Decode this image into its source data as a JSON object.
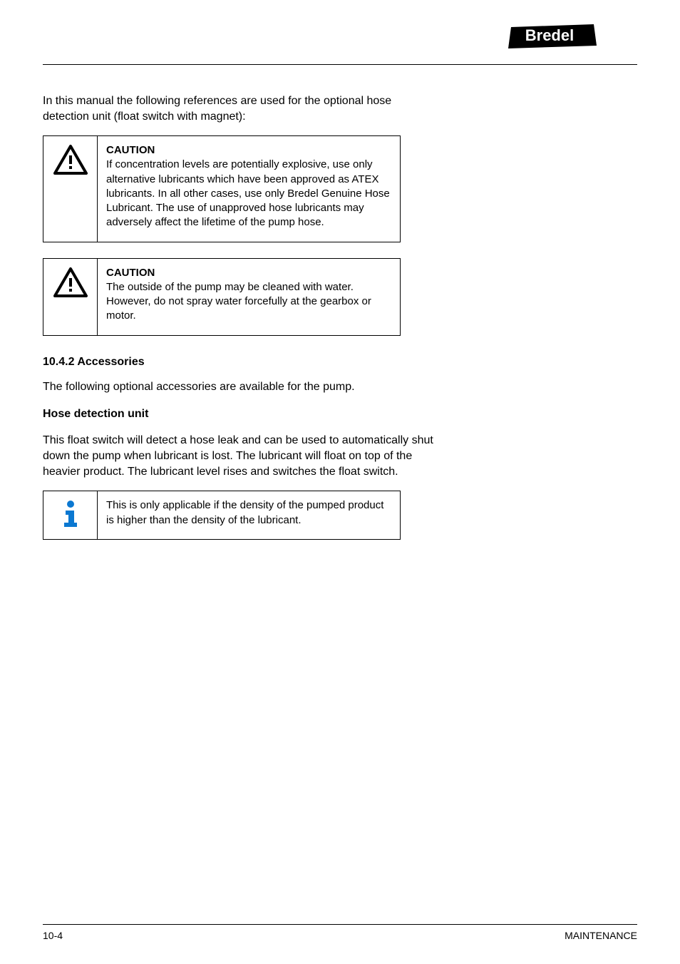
{
  "brand": "Bredel",
  "intro_paragraph": "In this manual the following references are used for the optional hose detection unit (float switch with magnet):",
  "callouts": [
    {
      "heading": "CAUTION",
      "body": "If concentration levels are potentially explosive, use only alternative lubricants which have been approved as ATEX lubricants. In all other cases, use only Bredel Genuine Hose Lubricant. The use of unapproved hose lubricants may adversely affect the lifetime of the pump hose."
    },
    {
      "heading": "CAUTION",
      "body": "The outside of the pump may be cleaned with water. However, do not spray water forcefully at the gearbox or motor."
    }
  ],
  "section_heading": "10.4.2   Accessories",
  "subsection_heading": "Hose detection unit",
  "accessories_paragraph_1": "The following optional accessories are available for the pump.",
  "accessories_paragraph_2": "This float switch will detect a hose leak and can be used to automatically shut down the pump when lubricant is lost. The lubricant will float on top of the heavier product. The lubricant level rises and switches the float switch.",
  "info_callout": "This is only applicable if the density of the pumped product is higher than the density of the lubricant.",
  "footer_left": "10-4",
  "footer_right": "MAINTENANCE"
}
